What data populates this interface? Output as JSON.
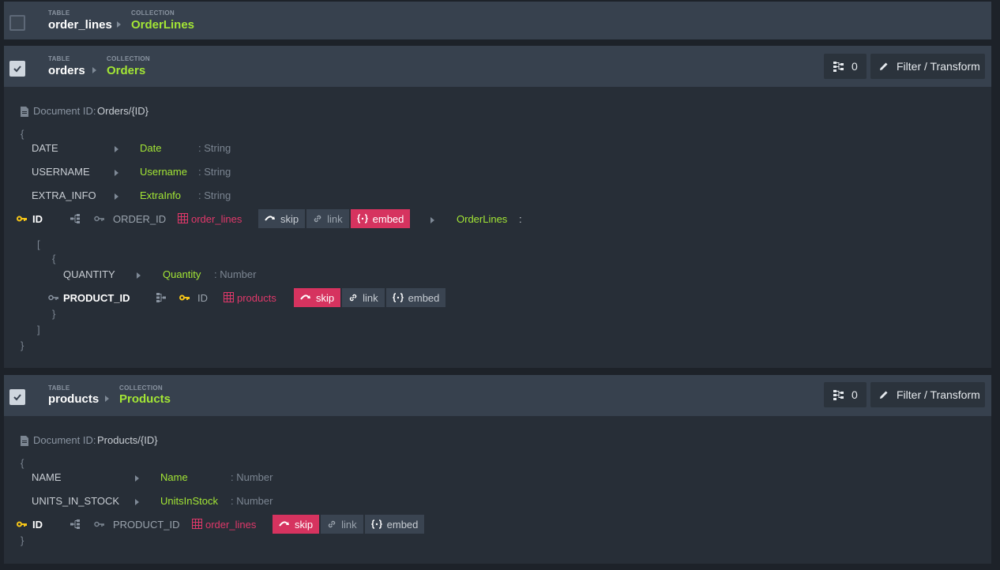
{
  "common": {
    "table_cap": "TABLE",
    "collection_cap": "COLLECTION",
    "doc_id_label": "Document ID:",
    "count": "0",
    "filter_label": "Filter / Transform",
    "open_brace": "{",
    "close_brace": "}",
    "open_bracket": "[",
    "close_bracket": "]",
    "skip": "skip",
    "link": "link",
    "embed": "embed",
    "id_label": "ID",
    "colon": ":"
  },
  "panels": [
    {
      "table": "order_lines",
      "collection": "OrderLines",
      "checked": false
    },
    {
      "table": "orders",
      "collection": "Orders",
      "checked": true,
      "doc_id": "Orders/{ID}",
      "fields": [
        {
          "column": "DATE",
          "property": "Date",
          "type": ": String"
        },
        {
          "column": "USERNAME",
          "property": "Username",
          "type": ": String"
        },
        {
          "column": "EXTRA_INFO",
          "property": "ExtraInfo",
          "type": ": String"
        }
      ],
      "relation": {
        "key": "ID",
        "fk": "ORDER_ID",
        "table": "order_lines",
        "active": "embed",
        "target": "OrderLines"
      },
      "nested": {
        "fields": [
          {
            "column": "QUANTITY",
            "property": "Quantity",
            "type": ": Number"
          }
        ],
        "relation": {
          "key": "PRODUCT_ID",
          "fk": "ID",
          "table": "products",
          "active": "skip"
        }
      }
    },
    {
      "table": "products",
      "collection": "Products",
      "checked": true,
      "doc_id": "Products/{ID}",
      "fields": [
        {
          "column": "NAME",
          "property": "Name",
          "type": ": Number"
        },
        {
          "column": "UNITS_IN_STOCK",
          "property": "UnitsInStock",
          "type": ": Number"
        }
      ],
      "relation": {
        "key": "ID",
        "fk": "PRODUCT_ID",
        "table": "order_lines",
        "active": "skip"
      }
    }
  ],
  "colors": {
    "accent_green": "#a3e635",
    "accent_pink": "#d6335f",
    "key_yellow": "#f5c518"
  }
}
